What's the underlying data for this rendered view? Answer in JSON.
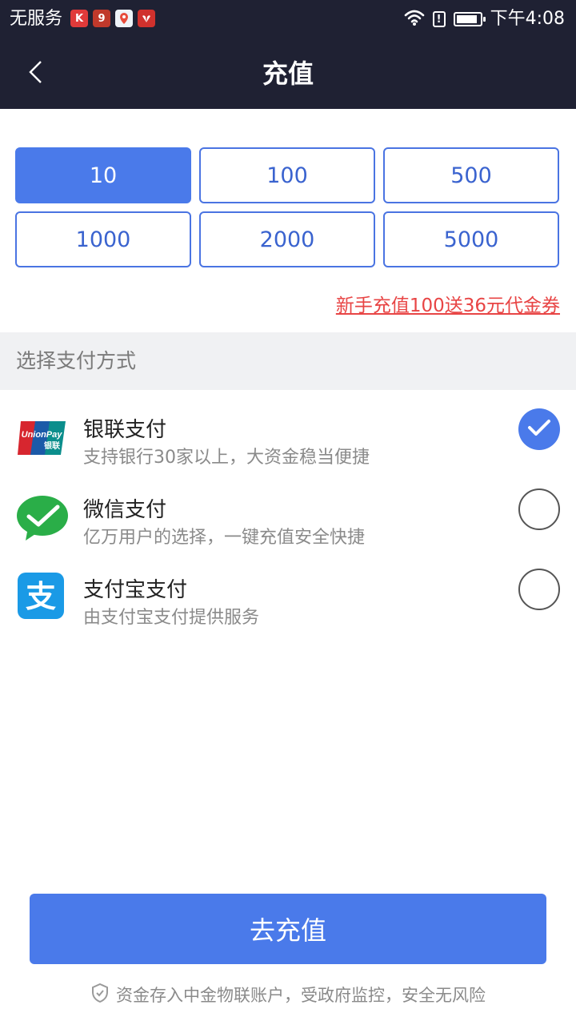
{
  "status_bar": {
    "carrier": "无服务",
    "time": "下午4:08",
    "battery_level": 0.9,
    "icons": [
      "kuaishou-app-icon",
      "91-app-icon",
      "baidu-map-app-icon",
      "huawei-app-icon",
      "wifi-icon",
      "alert-icon",
      "battery-icon"
    ]
  },
  "nav": {
    "title": "充值",
    "back_icon": "chevron-left-icon"
  },
  "amounts": {
    "options": [
      "10",
      "100",
      "500",
      "1000",
      "2000",
      "5000"
    ],
    "selected": "10",
    "promo": "新手充值100送36元代金券"
  },
  "payment": {
    "section_title": "选择支付方式",
    "methods": [
      {
        "name": "银联支付",
        "desc": "支持银行30家以上，大资金稳当便捷",
        "logo_text": "UnionPay",
        "logo_sub": "银联",
        "checked": true
      },
      {
        "name": "微信支付",
        "desc": "亿万用户的选择，一键充值安全快捷",
        "checked": false
      },
      {
        "name": "支付宝支付",
        "desc": "由支付宝支付提供服务",
        "logo_text": "支",
        "checked": false
      }
    ]
  },
  "submit": {
    "label": "去充值"
  },
  "footer": {
    "note": "资金存入中金物联账户，受政府监控，安全无风险",
    "icon": "shield-icon"
  },
  "colors": {
    "header_bg": "#1f2133",
    "accent": "#4a7aea",
    "promo": "#e84545",
    "section_bg": "#f0f1f3"
  }
}
